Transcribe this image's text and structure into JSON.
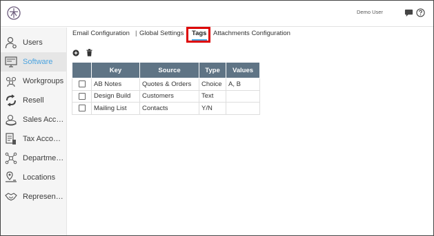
{
  "header": {
    "user_name": "Demo User",
    "logo_icon": "compass-logo-icon",
    "chat_icon": "chat-bubble-icon",
    "help_icon": "question-circle-icon"
  },
  "sidebar": {
    "items": [
      {
        "label": "Users",
        "icon": "user-gear-icon",
        "active": false
      },
      {
        "label": "Software",
        "icon": "monitor-icon",
        "active": true
      },
      {
        "label": "Workgroups",
        "icon": "group-icon",
        "active": false
      },
      {
        "label": "Resell",
        "icon": "recycle-icon",
        "active": false
      },
      {
        "label": "Sales Accounts",
        "icon": "coins-icon",
        "active": false
      },
      {
        "label": "Tax Accounts",
        "icon": "tax-document-icon",
        "active": false
      },
      {
        "label": "Departments",
        "icon": "network-icon",
        "active": false
      },
      {
        "label": "Locations",
        "icon": "map-pin-icon",
        "active": false
      },
      {
        "label": "Representatives",
        "icon": "handshake-icon",
        "active": false
      }
    ],
    "active_color": "#4aa3df"
  },
  "tabs": {
    "email": "Email Configuration",
    "separator": "|",
    "global": "Global Settings",
    "tags": "Tags",
    "attachments": "Attachments Configuration",
    "current": "Tags"
  },
  "toolbar": {
    "add_icon": "plus-circle-icon",
    "delete_icon": "trash-icon"
  },
  "table": {
    "headers": [
      "",
      "Key",
      "Source",
      "Type",
      "Values"
    ],
    "header_color": "#5f7485",
    "rows": [
      {
        "checked": false,
        "key": "AB Notes",
        "source": "Quotes & Orders",
        "type": "Choice",
        "values": "A, B"
      },
      {
        "checked": false,
        "key": "Design Build",
        "source": "Customers",
        "type": "Text",
        "values": ""
      },
      {
        "checked": false,
        "key": "Mailing List",
        "source": "Contacts",
        "type": "Y/N",
        "values": ""
      }
    ]
  },
  "highlight_color": "#dd0000"
}
